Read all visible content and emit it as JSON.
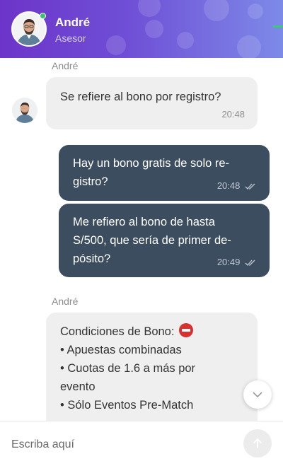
{
  "header": {
    "agent_name": "André",
    "agent_role": "Asesor",
    "gradient_start": "#6d34c9",
    "gradient_end": "#7d8ae8",
    "online_color": "#36c16c"
  },
  "messages": [
    {
      "direction": "incoming",
      "sender": "André",
      "text": "Se refiere al bono por registro?",
      "time": "20:48"
    },
    {
      "direction": "outgoing",
      "lines": [
        "Hay un bono gratis de solo re-",
        "gistro?"
      ],
      "time": "20:48",
      "status_icon": "double-check-icon"
    },
    {
      "direction": "outgoing",
      "lines": [
        "Me refiero al bono de hasta",
        "S/500, que sería de primer de-",
        "pósito?"
      ],
      "time": "20:49",
      "status_icon": "double-check-icon"
    },
    {
      "direction": "incoming",
      "sender": "André",
      "title": "Condiciones de Bono:",
      "title_icon": "no-entry-icon",
      "lines": [
        "• Apuestas combinadas",
        "• Cuotas de 1.6 a más por",
        "evento",
        "• Sólo Eventos Pre-Match"
      ]
    }
  ],
  "composer": {
    "placeholder": "Escriba aquí",
    "send_icon": "arrow-up-icon"
  },
  "scroll_button_icon": "chevron-down-icon",
  "colors": {
    "incoming_bubble": "#efefef",
    "outgoing_bubble": "#3c4d60",
    "no_entry_red": "#d92f2f"
  }
}
